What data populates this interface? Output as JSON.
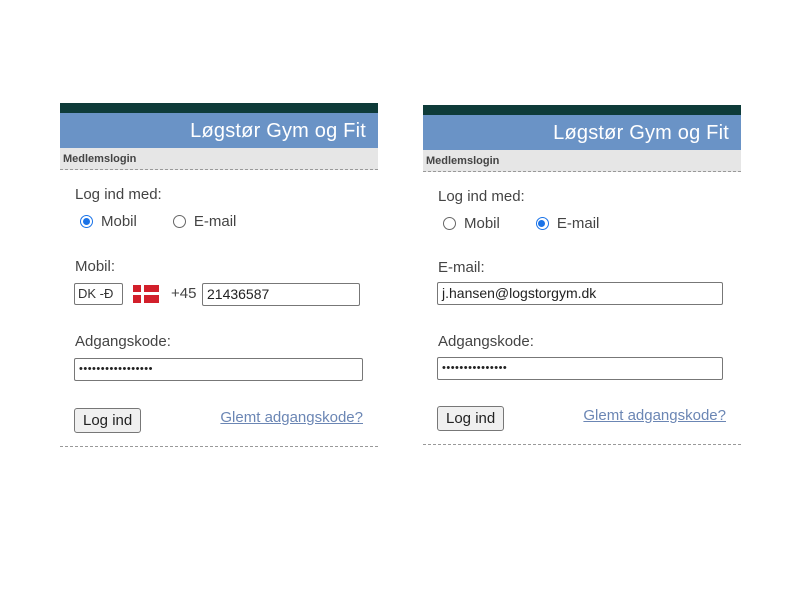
{
  "panels": [
    {
      "header_title": "Løgstør Gym og Fit",
      "subbar_title": "Medlemslogin",
      "login_with_label": "Log ind med:",
      "radio_mobile_label": "Mobil",
      "radio_email_label": "E-mail",
      "selected_method": "Mobil",
      "field_label": "Mobil:",
      "country_code": "DK -Ð",
      "flag_icon": "denmark-flag-icon",
      "phone_prefix": "+45",
      "field_value": "21436587",
      "password_label": "Adgangskode:",
      "password_value": "•••••••••••••••••",
      "login_button": "Log ind",
      "forgot_link": "Glemt adgangskode?"
    },
    {
      "header_title": "Løgstør Gym og Fit",
      "subbar_title": "Medlemslogin",
      "login_with_label": "Log ind med:",
      "radio_mobile_label": "Mobil",
      "radio_email_label": "E-mail",
      "selected_method": "E-mail",
      "field_label": "E-mail:",
      "field_value": "j.hansen@logstorgym.dk",
      "password_label": "Adgangskode:",
      "password_value": "•••••••••••••••",
      "login_button": "Log ind",
      "forgot_link": "Glemt adgangskode?"
    }
  ],
  "colors": {
    "top_bar": "#0e3b39",
    "header": "#6a93c6",
    "subbar": "#e6e6e6",
    "radio_selected": "#1a73e8",
    "link": "#6b86b4"
  }
}
